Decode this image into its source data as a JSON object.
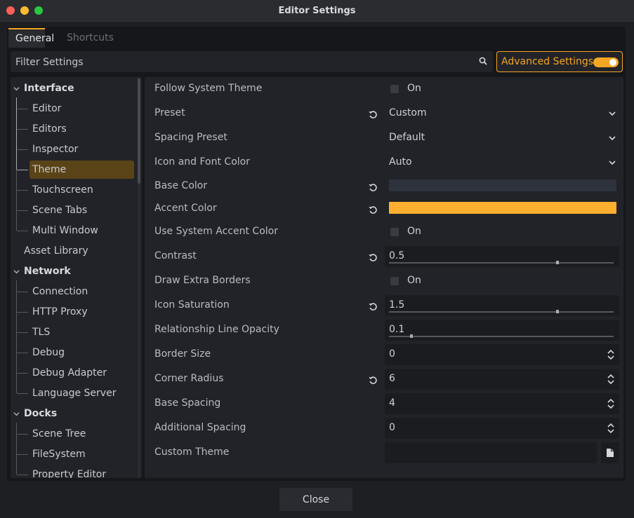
{
  "window": {
    "title": "Editor Settings"
  },
  "tabs": [
    {
      "label": "General"
    },
    {
      "label": "Shortcuts"
    }
  ],
  "filter": {
    "placeholder": "Filter Settings"
  },
  "advanced": {
    "label": "Advanced Settings",
    "enabled": true,
    "accent_color": "#f5a623"
  },
  "tree": {
    "items": [
      {
        "label": "Interface",
        "type": "category",
        "expanded": true
      },
      {
        "label": "Editor",
        "type": "child"
      },
      {
        "label": "Editors",
        "type": "child"
      },
      {
        "label": "Inspector",
        "type": "child"
      },
      {
        "label": "Theme",
        "type": "child",
        "selected": true
      },
      {
        "label": "Touchscreen",
        "type": "child"
      },
      {
        "label": "Scene Tabs",
        "type": "child"
      },
      {
        "label": "Multi Window",
        "type": "child"
      },
      {
        "label": "Asset Library",
        "type": "leaf"
      },
      {
        "label": "Network",
        "type": "category",
        "expanded": true
      },
      {
        "label": "Connection",
        "type": "child"
      },
      {
        "label": "HTTP Proxy",
        "type": "child"
      },
      {
        "label": "TLS",
        "type": "child"
      },
      {
        "label": "Debug",
        "type": "child"
      },
      {
        "label": "Debug Adapter",
        "type": "child"
      },
      {
        "label": "Language Server",
        "type": "child"
      },
      {
        "label": "Docks",
        "type": "category",
        "expanded": true
      },
      {
        "label": "Scene Tree",
        "type": "child"
      },
      {
        "label": "FileSystem",
        "type": "child"
      },
      {
        "label": "Property Editor",
        "type": "child"
      }
    ]
  },
  "settings": {
    "follow_system_theme": {
      "label": "Follow System Theme",
      "checked": false,
      "check_label": "On"
    },
    "preset": {
      "label": "Preset",
      "value": "Custom"
    },
    "spacing_preset": {
      "label": "Spacing Preset",
      "value": "Default"
    },
    "icon_font_color": {
      "label": "Icon and Font Color",
      "value": "Auto"
    },
    "base_color": {
      "label": "Base Color",
      "color": "#2e323c"
    },
    "accent_color": {
      "label": "Accent Color",
      "color": "#fdb02f"
    },
    "use_system_accent": {
      "label": "Use System Accent Color",
      "checked": false,
      "check_label": "On"
    },
    "contrast": {
      "label": "Contrast",
      "value": "0.5",
      "fraction": 0.75
    },
    "draw_extra_borders": {
      "label": "Draw Extra Borders",
      "checked": false,
      "check_label": "On"
    },
    "icon_saturation": {
      "label": "Icon Saturation",
      "value": "1.5",
      "fraction": 0.75
    },
    "relationship_line_opacity": {
      "label": "Relationship Line Opacity",
      "value": "0.1",
      "fraction": 0.1
    },
    "border_size": {
      "label": "Border Size",
      "value": "0"
    },
    "corner_radius": {
      "label": "Corner Radius",
      "value": "6"
    },
    "base_spacing": {
      "label": "Base Spacing",
      "value": "4"
    },
    "additional_spacing": {
      "label": "Additional Spacing",
      "value": "0"
    },
    "custom_theme": {
      "label": "Custom Theme",
      "value": ""
    }
  },
  "footer": {
    "close_label": "Close"
  }
}
